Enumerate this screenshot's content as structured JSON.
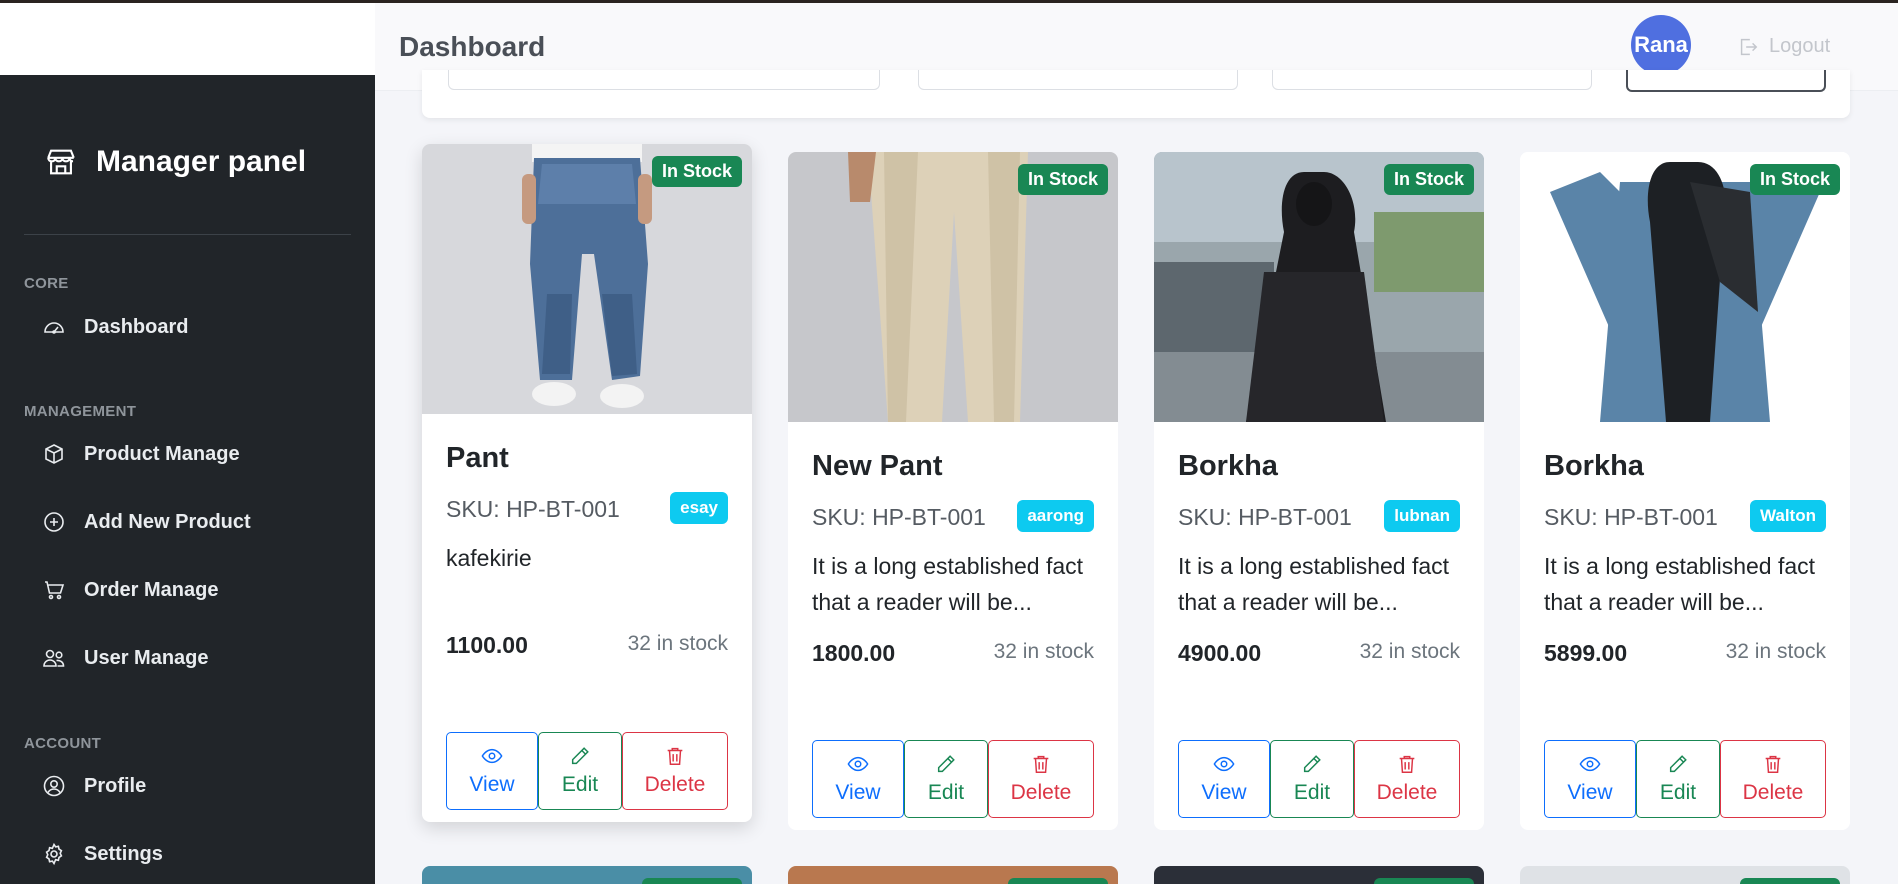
{
  "header": {
    "title": "Dashboard",
    "avatar_text": "Rana",
    "logout_label": "Logout"
  },
  "sidebar": {
    "brand": "Manager panel",
    "brand_icon": "store-icon",
    "sections": [
      {
        "heading": "CORE",
        "items": [
          {
            "label": "Dashboard",
            "icon": "speedometer-icon"
          }
        ]
      },
      {
        "heading": "MANAGEMENT",
        "items": [
          {
            "label": "Product Manage",
            "icon": "box-icon"
          },
          {
            "label": "Add New Product",
            "icon": "plus-circle-icon"
          },
          {
            "label": "Order Manage",
            "icon": "cart-icon"
          },
          {
            "label": "User Manage",
            "icon": "people-icon"
          }
        ]
      },
      {
        "heading": "ACCOUNT",
        "items": [
          {
            "label": "Profile",
            "icon": "person-circle-icon"
          },
          {
            "label": "Settings",
            "icon": "gear-icon"
          }
        ]
      }
    ]
  },
  "products": [
    {
      "name": "Pant",
      "sku": "SKU: HP-BT-001",
      "brand": "esay",
      "description": "kafekirie",
      "price": "1100.00",
      "stock": "32 in stock",
      "status": "In Stock"
    },
    {
      "name": "New Pant",
      "sku": "SKU: HP-BT-001",
      "brand": "aarong",
      "description": "It is a long established fact that a reader will be...",
      "price": "1800.00",
      "stock": "32 in stock",
      "status": "In Stock"
    },
    {
      "name": "Borkha",
      "sku": "SKU: HP-BT-001",
      "brand": "lubnan",
      "description": "It is a long established fact that a reader will be...",
      "price": "4900.00",
      "stock": "32 in stock",
      "status": "In Stock"
    },
    {
      "name": "Borkha",
      "sku": "SKU: HP-BT-001",
      "brand": "Walton",
      "description": "It is a long established fact that a reader will be...",
      "price": "5899.00",
      "stock": "32 in stock",
      "status": "In Stock"
    }
  ],
  "actions": {
    "view": "View",
    "edit": "Edit",
    "delete": "Delete"
  },
  "colors": {
    "sidebar_bg": "#212529",
    "in_stock": "#198754",
    "brand_badge": "#0dcaf0",
    "view": "#0d6efd",
    "edit": "#198754",
    "delete": "#dc3545",
    "avatar": "#4f6fe0"
  }
}
